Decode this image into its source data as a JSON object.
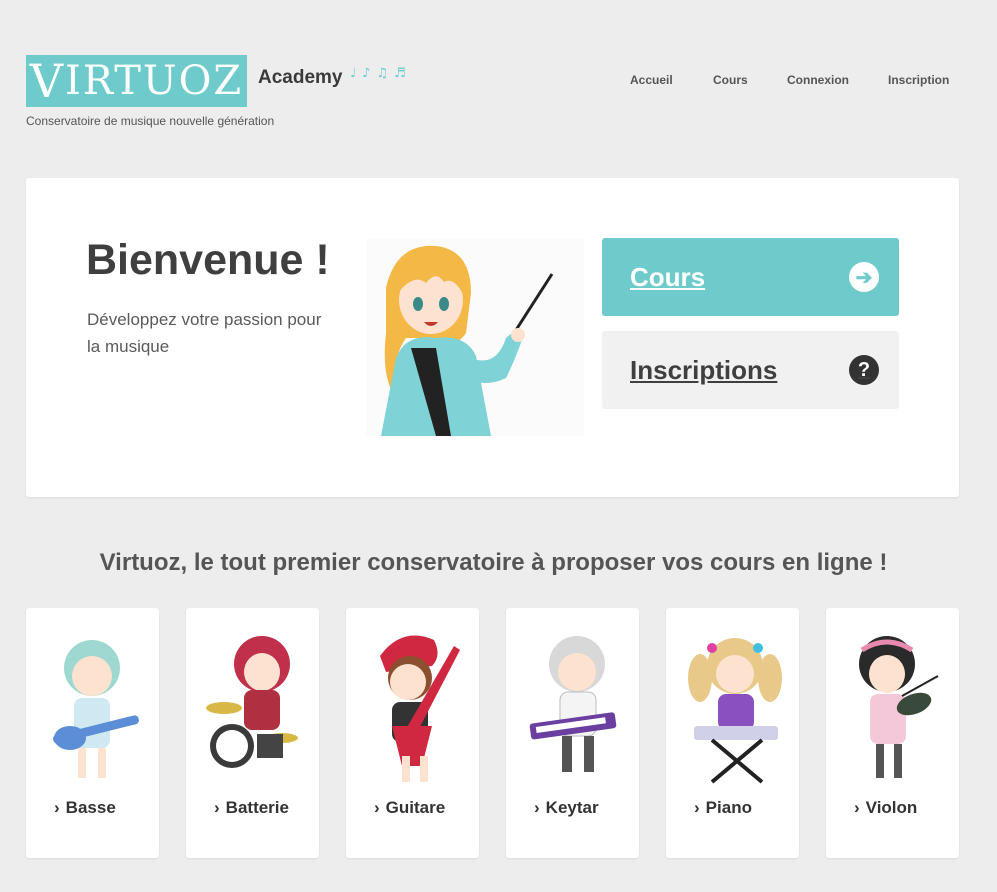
{
  "brand": {
    "name": "Virtuoz",
    "first_letter": "V",
    "rest_letters": "IRTUOZ",
    "academy": "Academy",
    "notes": "♩♪♫♬",
    "tagline": "Conservatoire de musique nouvelle génération"
  },
  "nav": {
    "items": [
      "Accueil",
      "Cours",
      "Connexion",
      "Inscription"
    ]
  },
  "hero": {
    "title": "Bienvenue !",
    "subtitle": "Développez votre passion pour la musique",
    "cta_primary": "Cours",
    "cta_secondary": "Inscriptions",
    "arrow_icon": "➔",
    "question_icon": "?"
  },
  "section": {
    "title": "Virtuoz, le tout premier conservatoire à proposer vos cours en ligne !"
  },
  "courses": [
    {
      "label": "Basse",
      "icon": "bass-guitar-character"
    },
    {
      "label": "Batterie",
      "icon": "drums-character"
    },
    {
      "label": "Guitare",
      "icon": "guitar-character"
    },
    {
      "label": "Keytar",
      "icon": "keytar-character"
    },
    {
      "label": "Piano",
      "icon": "piano-character"
    },
    {
      "label": "Violon",
      "icon": "violin-character"
    }
  ],
  "colors": {
    "accent": "#6fcbcb",
    "background": "#ededed",
    "card": "#ffffff",
    "text_dark": "#3f3f3f"
  }
}
